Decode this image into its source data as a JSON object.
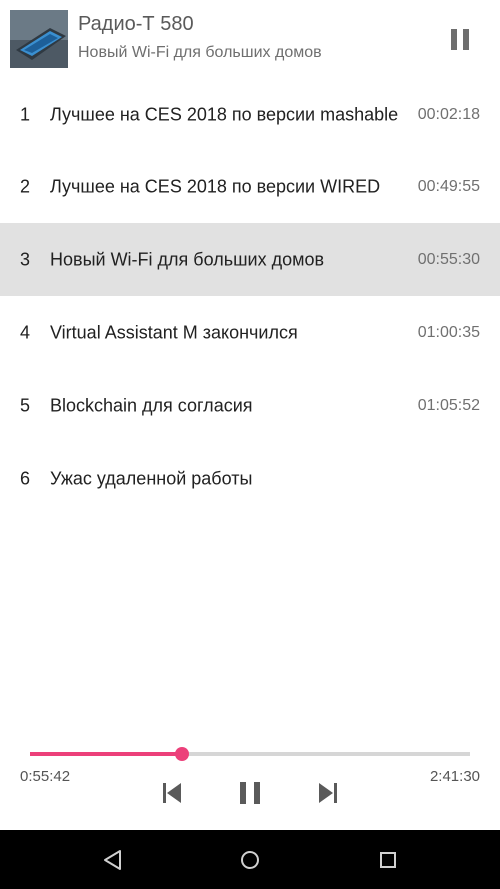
{
  "header": {
    "title": "Радио-Т 580",
    "subtitle": "Новый Wi-Fi для больших домов",
    "pause_icon": "pause-icon"
  },
  "chapters": [
    {
      "num": "1",
      "title": "Лучшее на CES 2018 по версии mashable",
      "time": "00:02:18"
    },
    {
      "num": "2",
      "title": "Лучшее на CES 2018 по версии WIRED",
      "time": "00:49:55"
    },
    {
      "num": "3",
      "title": "Новый Wi-Fi для больших домов",
      "time": "00:55:30"
    },
    {
      "num": "4",
      "title": "Virtual Assistant M закончился",
      "time": "01:00:35"
    },
    {
      "num": "5",
      "title": "Blockchain для согласия",
      "time": "01:05:52"
    },
    {
      "num": "6",
      "title": "Ужас удаленной работы",
      "time": ""
    }
  ],
  "active_chapter_index": 2,
  "player": {
    "elapsed": "0:55:42",
    "total": "2:41:30",
    "progress": 0.345,
    "accent_color": "#ec407a",
    "controls": [
      "skip-previous-icon",
      "pause-icon",
      "skip-next-icon"
    ]
  },
  "navbar": {
    "icons": [
      "back-triangle-icon",
      "home-circle-icon",
      "recents-square-icon"
    ]
  },
  "colors": {
    "active_row_bg": "#e1e1e1",
    "navbar_bg": "#000000"
  }
}
